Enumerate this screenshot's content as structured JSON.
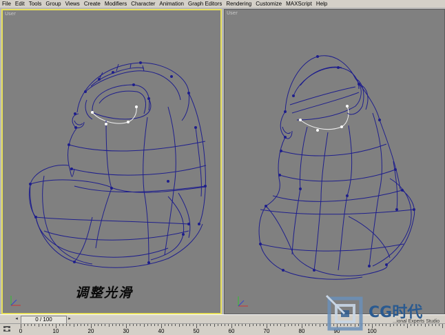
{
  "menu": [
    {
      "label": "File"
    },
    {
      "label": "Edit"
    },
    {
      "label": "Tools"
    },
    {
      "label": "Group"
    },
    {
      "label": "Views"
    },
    {
      "label": "Create"
    },
    {
      "label": "Modifiers"
    },
    {
      "label": "Character"
    },
    {
      "label": "Animation"
    },
    {
      "label": "Graph Editors"
    },
    {
      "label": "Rendering"
    },
    {
      "label": "Customize"
    },
    {
      "label": "MAXScript"
    },
    {
      "label": "Help"
    }
  ],
  "viewports": {
    "left": {
      "label": "User"
    },
    "right": {
      "label": "User"
    }
  },
  "caption": "调整光滑",
  "timeline": {
    "frame_display": "0 / 100"
  },
  "ruler": {
    "labels": [
      "0",
      "10",
      "20",
      "30",
      "40",
      "50",
      "60",
      "70",
      "80",
      "90",
      "100"
    ]
  },
  "watermark": {
    "brand": "CG时代",
    "subtitle": "...ional Experts Studio"
  },
  "colors": {
    "wire": "#1e1e8c",
    "active_border": "#e8e05a",
    "viewport_bg": "#808080"
  }
}
